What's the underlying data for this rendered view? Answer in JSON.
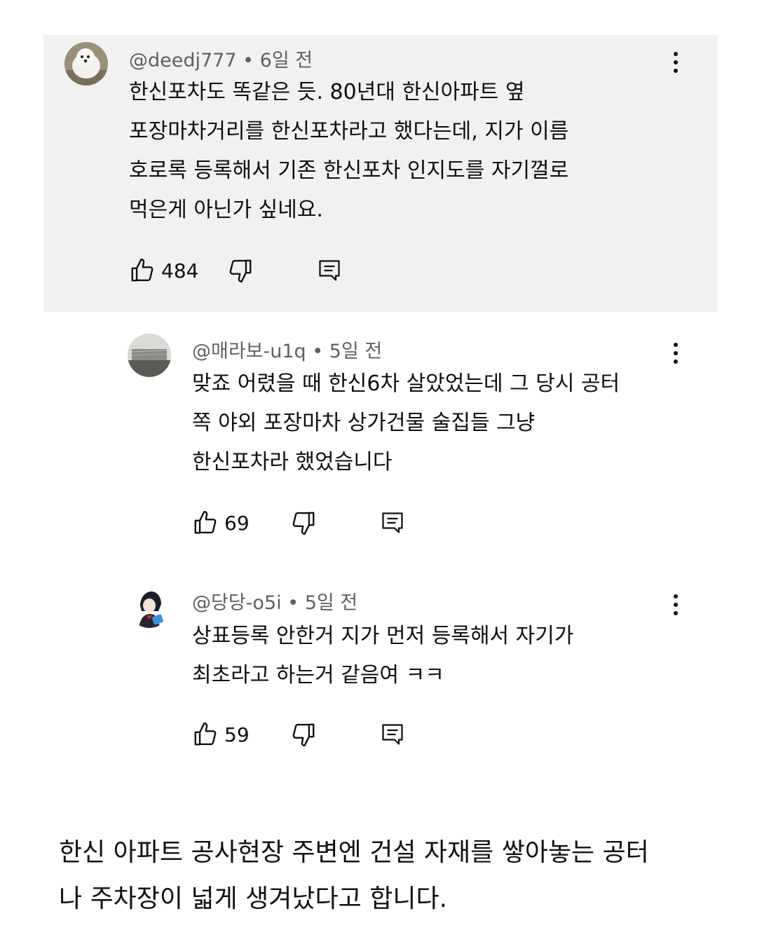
{
  "comments": [
    {
      "handle": "@deedj777",
      "time": "6일 전",
      "lines": [
        "한신포차도 똑같은 듯. 80년대 한신아파트 옆",
        "포장마차거리를 한신포차라고 했다는데, 지가 이름",
        "호로록 등록해서 기존 한신포차 인지도를 자기껄로",
        "먹은게 아닌가 싶네요."
      ],
      "likes": "484",
      "avatar_icon": "white-dog-avatar"
    },
    {
      "handle": "@매라보-u1q",
      "time": "5일 전",
      "lines": [
        "맞죠 어렸을 때 한신6차 살았었는데 그 당시 공터",
        "쪽 야외 포장마차 상가건물 술집들 그냥",
        "한신포차라 했었습니다"
      ],
      "likes": "69",
      "avatar_icon": "building-avatar"
    },
    {
      "handle": "@당당-o5i",
      "time": "5일 전",
      "lines": [
        "상표등록 안한거 지가 먼저 등록해서 자기가",
        "최초라고 하는거 같음여 ㅋㅋ"
      ],
      "likes": "59",
      "avatar_icon": "anime-character-avatar"
    }
  ],
  "separator": " • ",
  "article": {
    "lines": [
      "한신 아파트 공사현장 주변엔 건설 자재를 쌓아놓는 공터",
      "나 주차장이 넓게 생겨났다고 합니다."
    ]
  },
  "icons": {
    "like": "thumbs-up-icon",
    "dislike": "thumbs-down-icon",
    "reply": "reply-comment-icon",
    "menu": "more-vertical-icon"
  }
}
